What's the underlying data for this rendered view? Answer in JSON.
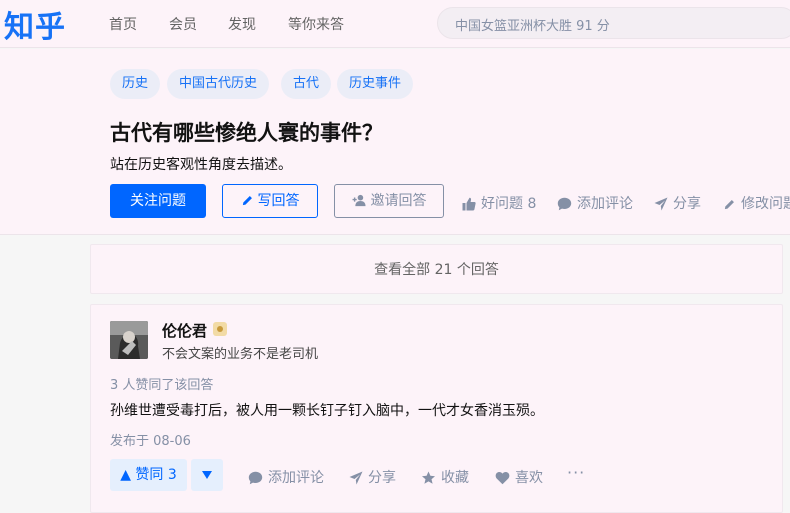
{
  "nav": {
    "logo": "知乎",
    "items": [
      "首页",
      "会员",
      "发现",
      "等你来答"
    ],
    "search_placeholder": "中国女篮亚洲杯大胜 91 分"
  },
  "question": {
    "tags": [
      "历史",
      "中国古代历史",
      "古代",
      "历史事件"
    ],
    "title": "古代有哪些惨绝人寰的事件？",
    "detail": "站在历史客观性角度去描述。",
    "follow_label": "关注问题",
    "write_answer_label": "写回答",
    "invite_label": "邀请回答",
    "good_question_label": "好问题 8",
    "add_comment_label": "添加评论",
    "share_label": "分享",
    "edit_label": "修改问题"
  },
  "view_all_label": "查看全部 21 个回答",
  "answer": {
    "author_name": "伦伦君",
    "author_bio": "不会文案的业务不是老司机",
    "votes_info": "3 人赞同了该回答",
    "content": "孙维世遭受毒打后，被人用一颗长钉子钉入脑中，一代才女香消玉殒。",
    "published": "发布于 08-06",
    "upvote_label": "▲ 赞同 3",
    "actions": {
      "comment": "添加评论",
      "share": "分享",
      "collect": "收藏",
      "like": "喜欢",
      "more": "···"
    }
  },
  "colors": {
    "brand": "#1772f6",
    "primary_button": "#0066ff",
    "page_bg": "#fdf3f9"
  }
}
